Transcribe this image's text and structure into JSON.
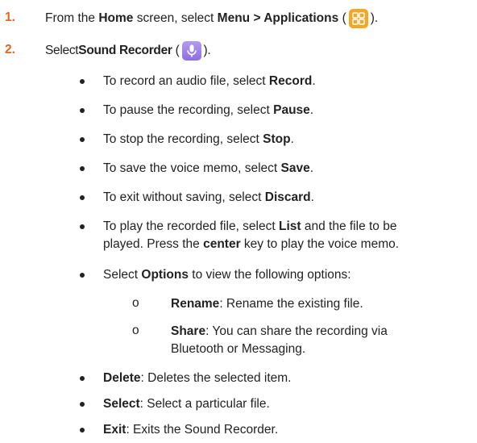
{
  "steps": [
    {
      "number": "1.",
      "parts": [
        "From the ",
        "Home",
        " screen, select ",
        "Menu > Applications",
        " (",
        ")."
      ],
      "icon": "apps-grid-icon"
    },
    {
      "number": "2.",
      "parts": [
        "Select ",
        "Sound Recorder",
        " (",
        ")."
      ],
      "icon": "microphone-icon"
    }
  ],
  "bullets": [
    {
      "pre": "To record an audio file, select ",
      "bold": "Record",
      "post": "."
    },
    {
      "pre": "To pause the recording, select ",
      "bold": "Pause",
      "post": "."
    },
    {
      "pre": "To stop the recording, select ",
      "bold": "Stop",
      "post": "."
    },
    {
      "pre": "To save the voice memo, select ",
      "bold": "Save",
      "post": "."
    },
    {
      "pre": "To exit without saving, select ",
      "bold": "Discard",
      "post": "."
    },
    {
      "line1_pre": "To play the recorded file, select ",
      "line1_bold": "List",
      "line1_post": " and the file to be",
      "line2_pre": "played. Press the ",
      "line2_bold": "center",
      "line2_post": " key to play the voice memo."
    },
    {
      "pre": "Select ",
      "bold": "Options",
      "post": " to view the following options:"
    },
    {
      "bold": "Delete",
      "post": ": Deletes the selected item."
    },
    {
      "bold": "Select",
      "post": ": Select a particular file."
    },
    {
      "bold": "Exit",
      "post": ": Exits the Sound Recorder."
    }
  ],
  "sub_marker": "o",
  "sub_items": [
    {
      "bold": "Rename",
      "post": ": Rename the existing file."
    },
    {
      "bold": "Share",
      "post": ": You can share the recording via",
      "line2": "Bluetooth or Messaging."
    }
  ],
  "colors": {
    "step_number": "#e8641c",
    "apps_icon": "#f5a623",
    "mic_icon": "#9b7fe8"
  }
}
